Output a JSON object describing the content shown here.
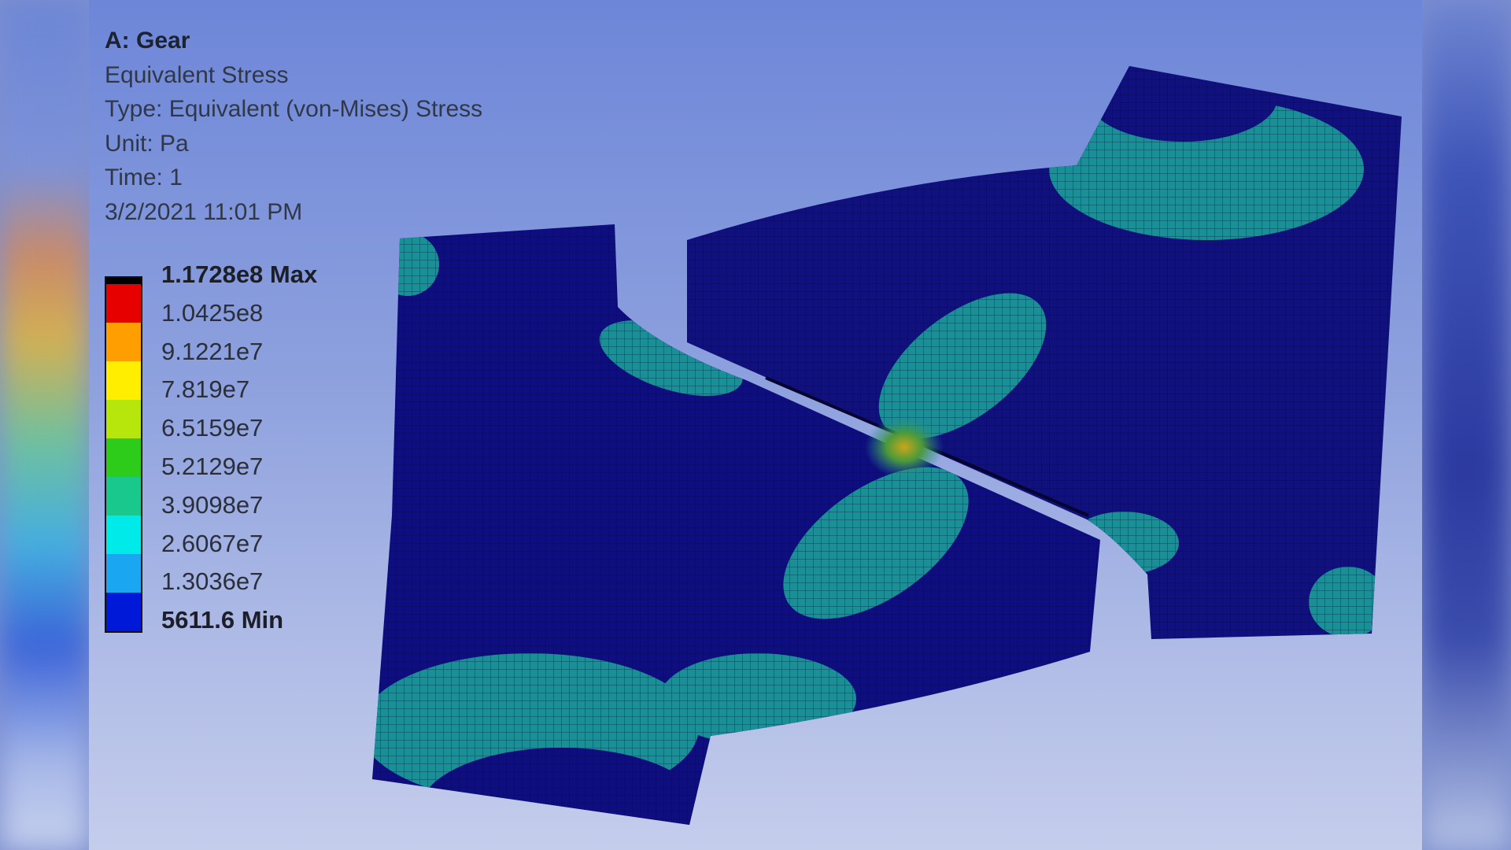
{
  "header": {
    "title": "A: Gear",
    "result_name": "Equivalent Stress",
    "type": "Type: Equivalent (von-Mises) Stress",
    "unit": "Unit: Pa",
    "time": "Time: 1",
    "timestamp": "3/2/2021 11:01 PM"
  },
  "legend": {
    "max_label": "1.1728e8 Max",
    "levels": [
      "1.0425e8",
      "9.1221e7",
      "7.819e7",
      "6.5159e7",
      "5.2129e7",
      "3.9098e7",
      "2.6067e7",
      "1.3036e7"
    ],
    "min_label": "5611.6 Min",
    "colors": [
      "#000000",
      "#e60000",
      "#ff9e00",
      "#ffee00",
      "#b7e60c",
      "#2ecc1a",
      "#19c88c",
      "#00eaea",
      "#1aa6f0",
      "#0018d8"
    ]
  },
  "model": {
    "base_color": "#0f0e80",
    "mid_stress_color": "#1b8f96",
    "hot_spot_color": "#b19a22"
  }
}
